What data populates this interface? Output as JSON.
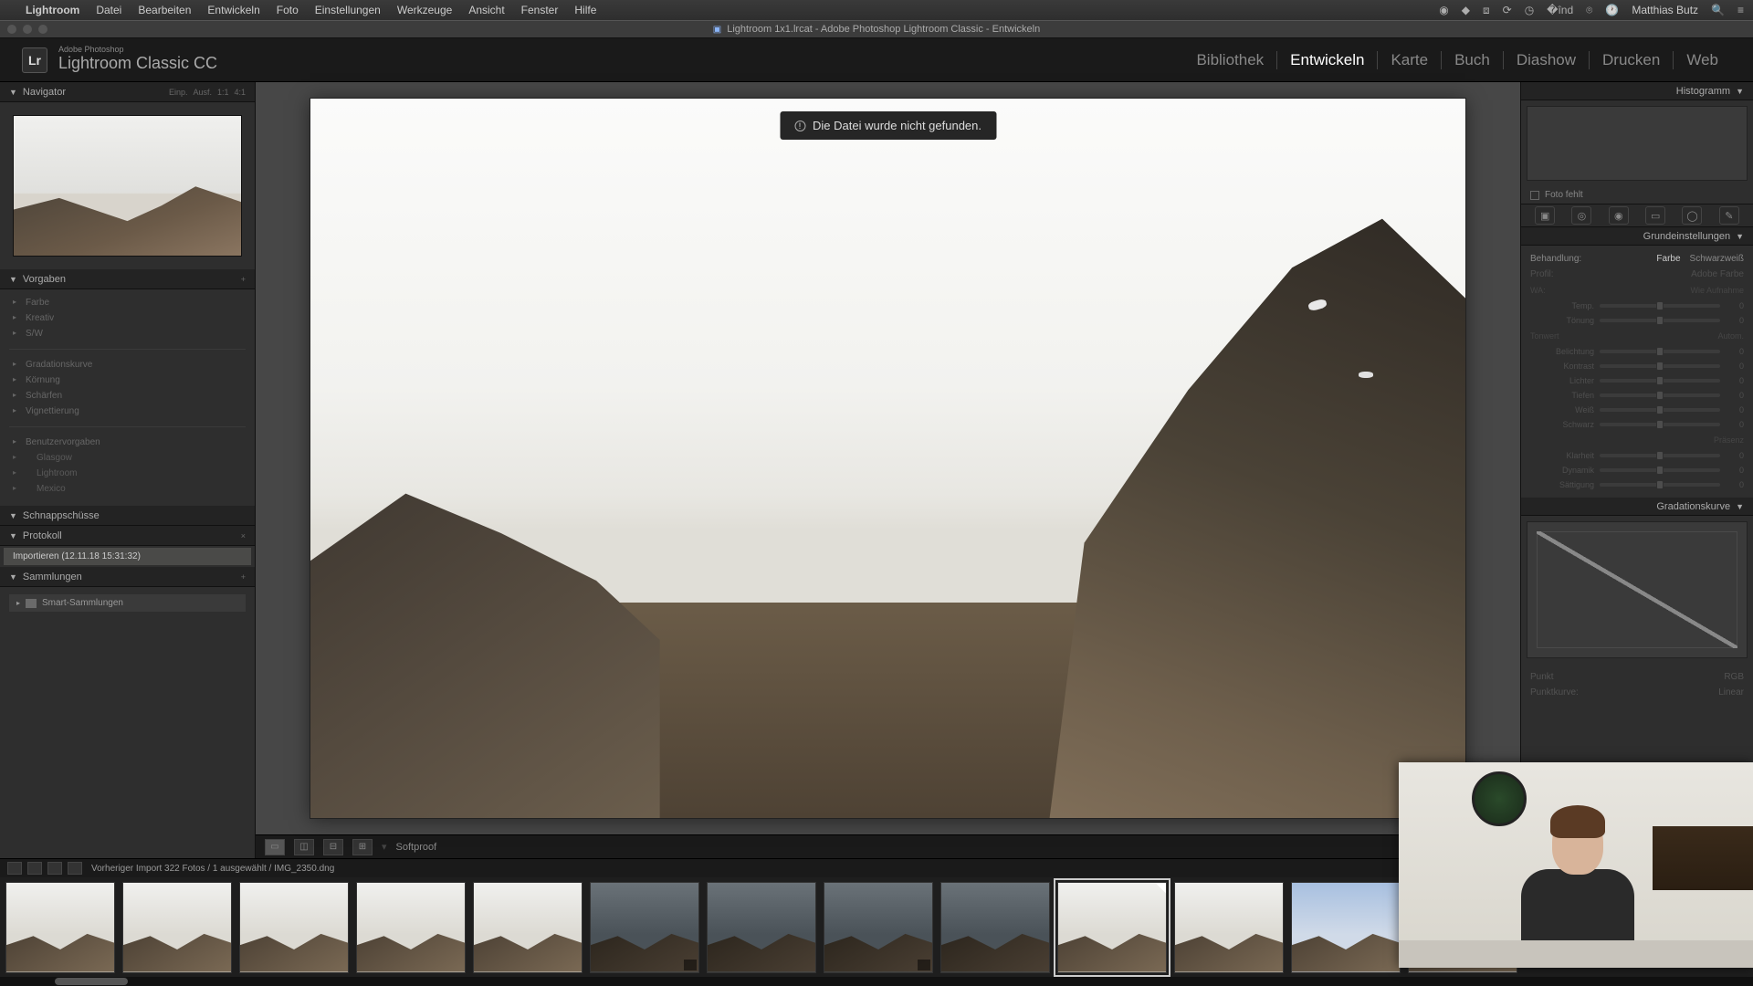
{
  "menubar": {
    "app": "Lightroom",
    "items": [
      "Datei",
      "Bearbeiten",
      "Entwickeln",
      "Foto",
      "Einstellungen",
      "Werkzeuge",
      "Ansicht",
      "Fenster",
      "Hilfe"
    ],
    "user": "Matthias Butz"
  },
  "window": {
    "title": "Lightroom 1x1.lrcat - Adobe Photoshop Lightroom Classic - Entwickeln"
  },
  "brand": {
    "logo_small": "Adobe Photoshop",
    "logo_big": "Lightroom Classic CC",
    "logo_abbrev": "Lr"
  },
  "modules": [
    {
      "label": "Bibliothek",
      "active": false
    },
    {
      "label": "Entwickeln",
      "active": true
    },
    {
      "label": "Karte",
      "active": false
    },
    {
      "label": "Buch",
      "active": false
    },
    {
      "label": "Diashow",
      "active": false
    },
    {
      "label": "Drucken",
      "active": false
    },
    {
      "label": "Web",
      "active": false
    }
  ],
  "left": {
    "navigator": {
      "title": "Navigator",
      "zoom": [
        "Einp.",
        "Ausf.",
        "1:1",
        "4:1"
      ]
    },
    "presets": {
      "title": "Vorgaben",
      "top_items": [
        "Farbe",
        "Kreativ",
        "S/W"
      ],
      "mid_items": [
        "Gradationskurve",
        "Körnung",
        "Schärfen",
        "Vignettierung"
      ],
      "user_header": "Benutzervorgaben",
      "user_items": [
        "Glasgow",
        "Lightroom",
        "Mexico"
      ]
    },
    "snapshots": {
      "title": "Schnappschüsse"
    },
    "history": {
      "title": "Protokoll",
      "entry": "Importieren (12.11.18 15:31:32)"
    },
    "collections": {
      "title": "Sammlungen",
      "smart": "Smart-Sammlungen"
    }
  },
  "center": {
    "error": "Die Datei wurde nicht gefunden.",
    "toolbar": {
      "softproof": "Softproof"
    }
  },
  "right": {
    "histogram": {
      "title": "Histogramm"
    },
    "missing": "Foto fehlt",
    "basic": {
      "title": "Grundeinstellungen",
      "treat_label": "Behandlung:",
      "treat_color": "Farbe",
      "treat_bw": "Schwarzweiß",
      "profile_label": "Profil:",
      "profile_value": "Adobe Farbe",
      "wb_label": "WA:",
      "wb_value": "Wie Aufnahme",
      "sliders_wb": [
        {
          "label": "Temp.",
          "val": "0"
        },
        {
          "label": "Tönung",
          "val": "0"
        }
      ],
      "tone_head": "Tonwert",
      "tone_auto": "Autom.",
      "sliders_tone": [
        {
          "label": "Belichtung",
          "val": "0"
        },
        {
          "label": "Kontrast",
          "val": "0"
        },
        {
          "label": "Lichter",
          "val": "0"
        },
        {
          "label": "Tiefen",
          "val": "0"
        },
        {
          "label": "Weiß",
          "val": "0"
        },
        {
          "label": "Schwarz",
          "val": "0"
        }
      ],
      "presence_head": "Präsenz",
      "sliders_presence": [
        {
          "label": "Klarheit",
          "val": "0"
        },
        {
          "label": "Dynamik",
          "val": "0"
        },
        {
          "label": "Sättigung",
          "val": "0"
        }
      ]
    },
    "curve": {
      "title": "Gradationskurve",
      "region": "Punkt",
      "channel": "RGB"
    },
    "pointcurve_label": "Punktkurve:",
    "pointcurve_value": "Linear"
  },
  "filmstrip": {
    "info": "Vorheriger Import   322 Fotos / 1 ausgewählt / IMG_2350.dng",
    "thumbs": [
      {
        "variant": "light"
      },
      {
        "variant": "light"
      },
      {
        "variant": "light"
      },
      {
        "variant": "light"
      },
      {
        "variant": "light"
      },
      {
        "variant": "dark",
        "badge": true
      },
      {
        "variant": "dark"
      },
      {
        "variant": "dark",
        "badge": true
      },
      {
        "variant": "dark"
      },
      {
        "variant": "light",
        "selected": true,
        "flag": true
      },
      {
        "variant": "light"
      },
      {
        "variant": "blue"
      },
      {
        "variant": "blue"
      }
    ]
  }
}
